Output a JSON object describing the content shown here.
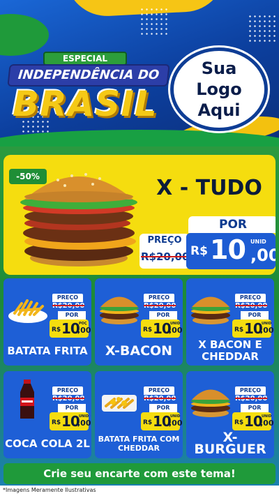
{
  "header": {
    "especial": "ESPECIAL",
    "line1": "INDEPENDÊNCIA DO",
    "line2": "BRASIL",
    "logo_text": "Sua Logo Aqui"
  },
  "hero": {
    "discount": "-50%",
    "title": "X - TUDO",
    "preco_label": "PREÇO",
    "old_price": "R$20,00",
    "por_label": "POR",
    "currency": "R$",
    "price": "10",
    "cents": ",00",
    "unit": "UNID"
  },
  "cards": [
    {
      "name": "BATATA FRITA",
      "preco": "PREÇO",
      "old": "R$20,00",
      "por": "POR",
      "currency": "R$",
      "price": "10",
      "cents": ",00",
      "unit": "POÇ",
      "image": "fries-icon"
    },
    {
      "name": "X-BACON",
      "preco": "PREÇO",
      "old": "R$20,00",
      "por": "POR",
      "currency": "R$",
      "price": "10",
      "cents": ",00",
      "unit": "UNID",
      "image": "burger-icon"
    },
    {
      "name": "X BACON E CHEDDAR",
      "preco": "PREÇO",
      "old": "R$20,00",
      "por": "POR",
      "currency": "R$",
      "price": "10",
      "cents": ",00",
      "unit": "UNID",
      "image": "burger-icon"
    },
    {
      "name": "COCA COLA 2L",
      "preco": "PREÇO",
      "old": "R$20,00",
      "por": "POR",
      "currency": "R$",
      "price": "10",
      "cents": ",00",
      "unit": "UNID",
      "image": "soda-bottle-icon"
    },
    {
      "name": "BATATA FRITA COM CHEDDAR",
      "preco": "PREÇO",
      "old": "R$20,00",
      "por": "POR",
      "currency": "R$",
      "price": "10",
      "cents": ",00",
      "unit": "UNID",
      "image": "fries-cheddar-icon"
    },
    {
      "name": "X-BURGUER",
      "preco": "PREÇO",
      "old": "R$20,00",
      "por": "POR",
      "currency": "R$",
      "price": "10",
      "cents": ",00",
      "unit": "UNID",
      "image": "burger-icon"
    }
  ],
  "cta": "Crie seu encarte com este tema!",
  "footer_note": "*Imagens Meramente Ilustrativas",
  "colors": {
    "blue": "#1e5fd6",
    "green": "#1f9a3a",
    "yellow": "#f5dd0f",
    "navy": "#0b1b3a"
  }
}
